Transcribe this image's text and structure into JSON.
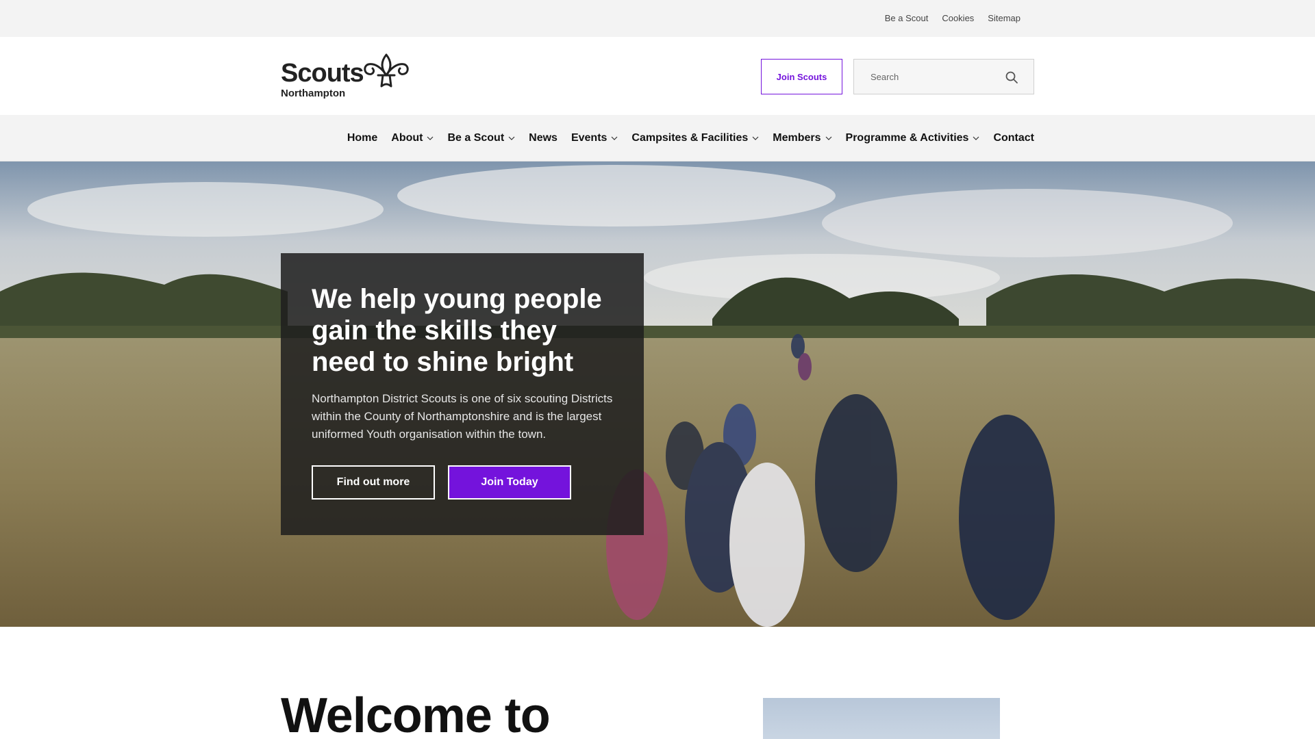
{
  "utility_nav": {
    "links": [
      "Be a Scout",
      "Cookies",
      "Sitemap"
    ]
  },
  "header": {
    "logo_word": "Scouts",
    "logo_sub": "Northampton",
    "join_label": "Join Scouts",
    "search_placeholder": "Search"
  },
  "nav": {
    "items": [
      {
        "label": "Home",
        "dropdown": false
      },
      {
        "label": "About",
        "dropdown": true
      },
      {
        "label": "Be a Scout",
        "dropdown": true
      },
      {
        "label": "News",
        "dropdown": false
      },
      {
        "label": "Events",
        "dropdown": true
      },
      {
        "label": "Campsites & Facilities",
        "dropdown": true
      },
      {
        "label": "Members",
        "dropdown": true
      },
      {
        "label": "Programme & Activities",
        "dropdown": true
      },
      {
        "label": "Contact",
        "dropdown": false
      }
    ]
  },
  "hero": {
    "title": "We help young people gain the skills they need to shine bright",
    "text": "Northampton District Scouts is one of six scouting Districts within the County of Northamptonshire and is the largest uniformed Youth organisation within the town.",
    "find_out_label": "Find out more",
    "join_today_label": "Join Today"
  },
  "welcome": {
    "heading": "Welcome to"
  },
  "colors": {
    "accent": "#7413dc",
    "util_bg": "#f3f3f3"
  },
  "icons": {
    "search": "search-icon",
    "chevron": "chevron-down-icon",
    "logo": "fleur-de-lis-icon"
  }
}
